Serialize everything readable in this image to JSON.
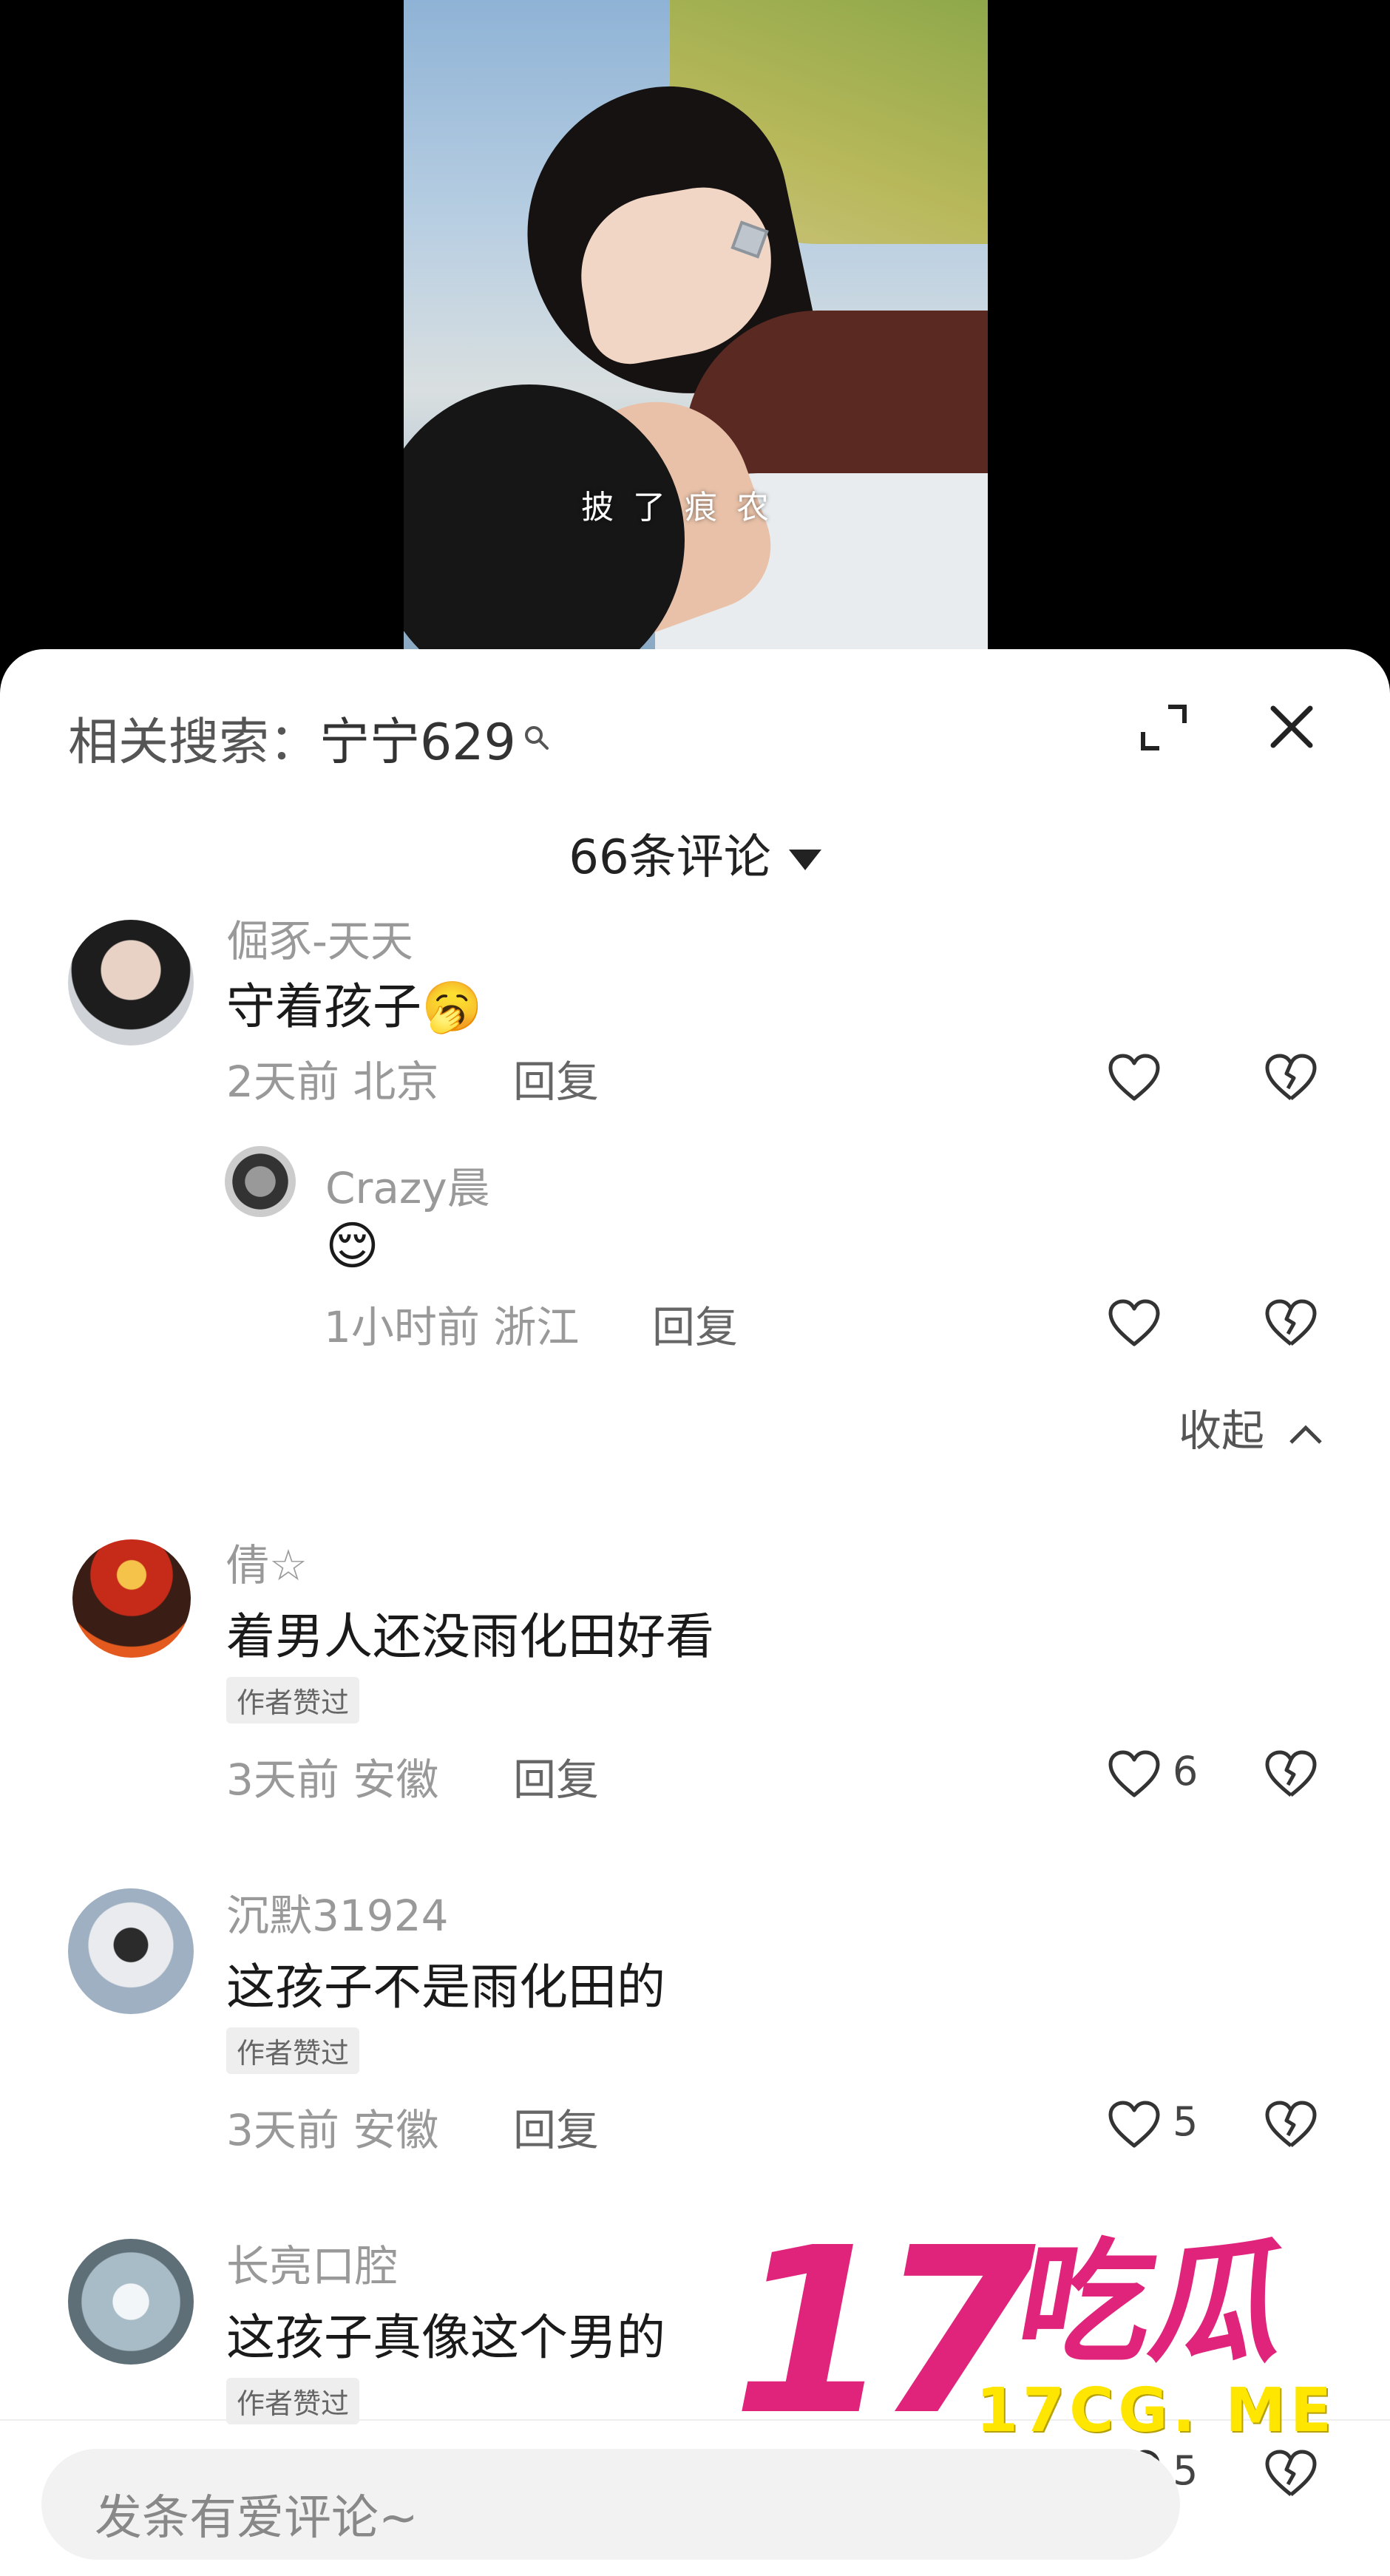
{
  "video": {
    "overlay_text": "披了痕农"
  },
  "search": {
    "prefix": "相关搜索：",
    "query": "宁宁629"
  },
  "comments_count": "66条评论",
  "comments": [
    {
      "user": "倔豕-天天",
      "text": "守着孩子",
      "emoji": "🥱",
      "time": "2天前",
      "location": "北京",
      "reply_label": "回复",
      "reply": {
        "user": "Crazy晨",
        "text": "",
        "emoji": "😌",
        "time": "1小时前",
        "location": "浙江",
        "reply_label": "回复"
      },
      "collapse_label": "收起"
    },
    {
      "user": "倩☆",
      "text": "着男人还没雨化田好看",
      "badge": "作者赞过",
      "time": "3天前",
      "location": "安徽",
      "reply_label": "回复",
      "likes": "6"
    },
    {
      "user": "沉默31924",
      "text": "这孩子不是雨化田的",
      "badge": "作者赞过",
      "time": "3天前",
      "location": "安徽",
      "reply_label": "回复",
      "likes": "5"
    },
    {
      "user": "长亮口腔",
      "text": "这孩子真像这个男的",
      "badge": "作者赞过",
      "likes": "5"
    }
  ],
  "input": {
    "placeholder": "发条有爱评论~"
  },
  "watermark": {
    "number": "17",
    "name": "吃瓜",
    "url": "17CG. ME"
  },
  "colors": {
    "watermark_pink": "#e0247b",
    "watermark_yellow": "#ffe600"
  }
}
